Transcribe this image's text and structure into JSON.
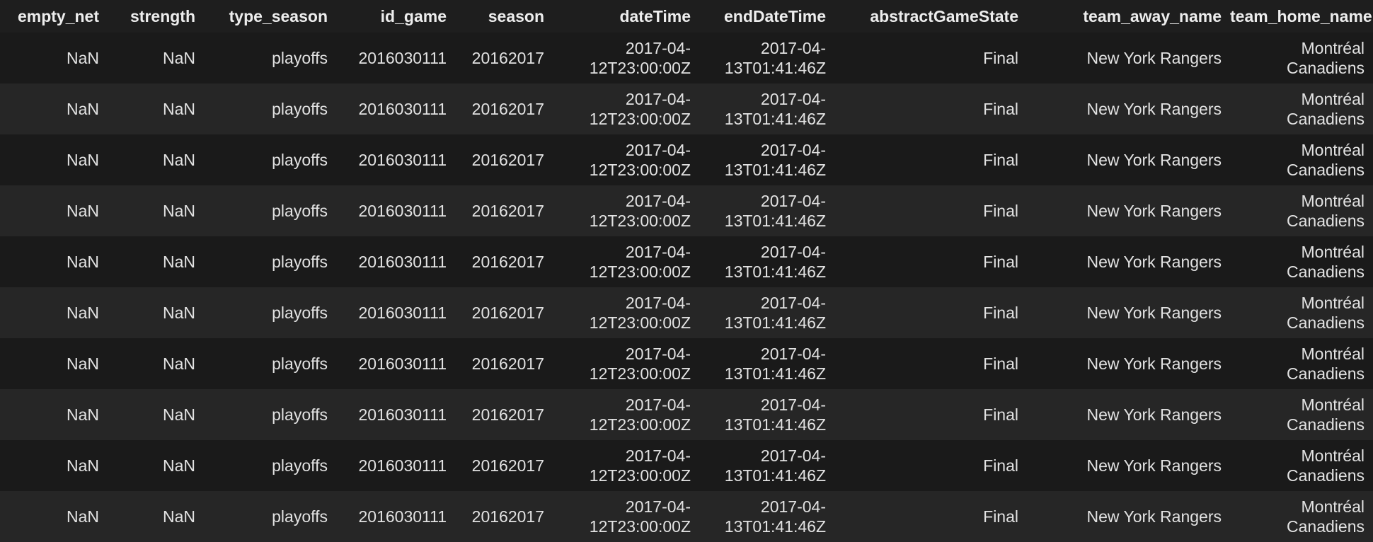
{
  "table": {
    "columns": [
      {
        "key": "empty_net",
        "label": "empty_net"
      },
      {
        "key": "strength",
        "label": "strength"
      },
      {
        "key": "type_season",
        "label": "type_season"
      },
      {
        "key": "id_game",
        "label": "id_game"
      },
      {
        "key": "season",
        "label": "season"
      },
      {
        "key": "dateTime",
        "label": "dateTime"
      },
      {
        "key": "endDateTime",
        "label": "endDateTime"
      },
      {
        "key": "abstractGameState",
        "label": "abstractGameState"
      },
      {
        "key": "team_away_name",
        "label": "team_away_name"
      },
      {
        "key": "team_home_name",
        "label": "team_home_name"
      }
    ],
    "rows": [
      {
        "empty_net": "NaN",
        "strength": "NaN",
        "type_season": "playoffs",
        "id_game": "2016030111",
        "season": "20162017",
        "dateTime": "2017-04-\n12T23:00:00Z",
        "endDateTime": "2017-04-\n13T01:41:46Z",
        "abstractGameState": "Final",
        "team_away_name": "New York Rangers",
        "team_home_name": "Montréal\nCanadiens"
      },
      {
        "empty_net": "NaN",
        "strength": "NaN",
        "type_season": "playoffs",
        "id_game": "2016030111",
        "season": "20162017",
        "dateTime": "2017-04-\n12T23:00:00Z",
        "endDateTime": "2017-04-\n13T01:41:46Z",
        "abstractGameState": "Final",
        "team_away_name": "New York Rangers",
        "team_home_name": "Montréal\nCanadiens"
      },
      {
        "empty_net": "NaN",
        "strength": "NaN",
        "type_season": "playoffs",
        "id_game": "2016030111",
        "season": "20162017",
        "dateTime": "2017-04-\n12T23:00:00Z",
        "endDateTime": "2017-04-\n13T01:41:46Z",
        "abstractGameState": "Final",
        "team_away_name": "New York Rangers",
        "team_home_name": "Montréal\nCanadiens"
      },
      {
        "empty_net": "NaN",
        "strength": "NaN",
        "type_season": "playoffs",
        "id_game": "2016030111",
        "season": "20162017",
        "dateTime": "2017-04-\n12T23:00:00Z",
        "endDateTime": "2017-04-\n13T01:41:46Z",
        "abstractGameState": "Final",
        "team_away_name": "New York Rangers",
        "team_home_name": "Montréal\nCanadiens"
      },
      {
        "empty_net": "NaN",
        "strength": "NaN",
        "type_season": "playoffs",
        "id_game": "2016030111",
        "season": "20162017",
        "dateTime": "2017-04-\n12T23:00:00Z",
        "endDateTime": "2017-04-\n13T01:41:46Z",
        "abstractGameState": "Final",
        "team_away_name": "New York Rangers",
        "team_home_name": "Montréal\nCanadiens"
      },
      {
        "empty_net": "NaN",
        "strength": "NaN",
        "type_season": "playoffs",
        "id_game": "2016030111",
        "season": "20162017",
        "dateTime": "2017-04-\n12T23:00:00Z",
        "endDateTime": "2017-04-\n13T01:41:46Z",
        "abstractGameState": "Final",
        "team_away_name": "New York Rangers",
        "team_home_name": "Montréal\nCanadiens"
      },
      {
        "empty_net": "NaN",
        "strength": "NaN",
        "type_season": "playoffs",
        "id_game": "2016030111",
        "season": "20162017",
        "dateTime": "2017-04-\n12T23:00:00Z",
        "endDateTime": "2017-04-\n13T01:41:46Z",
        "abstractGameState": "Final",
        "team_away_name": "New York Rangers",
        "team_home_name": "Montréal\nCanadiens"
      },
      {
        "empty_net": "NaN",
        "strength": "NaN",
        "type_season": "playoffs",
        "id_game": "2016030111",
        "season": "20162017",
        "dateTime": "2017-04-\n12T23:00:00Z",
        "endDateTime": "2017-04-\n13T01:41:46Z",
        "abstractGameState": "Final",
        "team_away_name": "New York Rangers",
        "team_home_name": "Montréal\nCanadiens"
      },
      {
        "empty_net": "NaN",
        "strength": "NaN",
        "type_season": "playoffs",
        "id_game": "2016030111",
        "season": "20162017",
        "dateTime": "2017-04-\n12T23:00:00Z",
        "endDateTime": "2017-04-\n13T01:41:46Z",
        "abstractGameState": "Final",
        "team_away_name": "New York Rangers",
        "team_home_name": "Montréal\nCanadiens"
      },
      {
        "empty_net": "NaN",
        "strength": "NaN",
        "type_season": "playoffs",
        "id_game": "2016030111",
        "season": "20162017",
        "dateTime": "2017-04-\n12T23:00:00Z",
        "endDateTime": "2017-04-\n13T01:41:46Z",
        "abstractGameState": "Final",
        "team_away_name": "New York Rangers",
        "team_home_name": "Montréal\nCanadiens"
      }
    ]
  }
}
